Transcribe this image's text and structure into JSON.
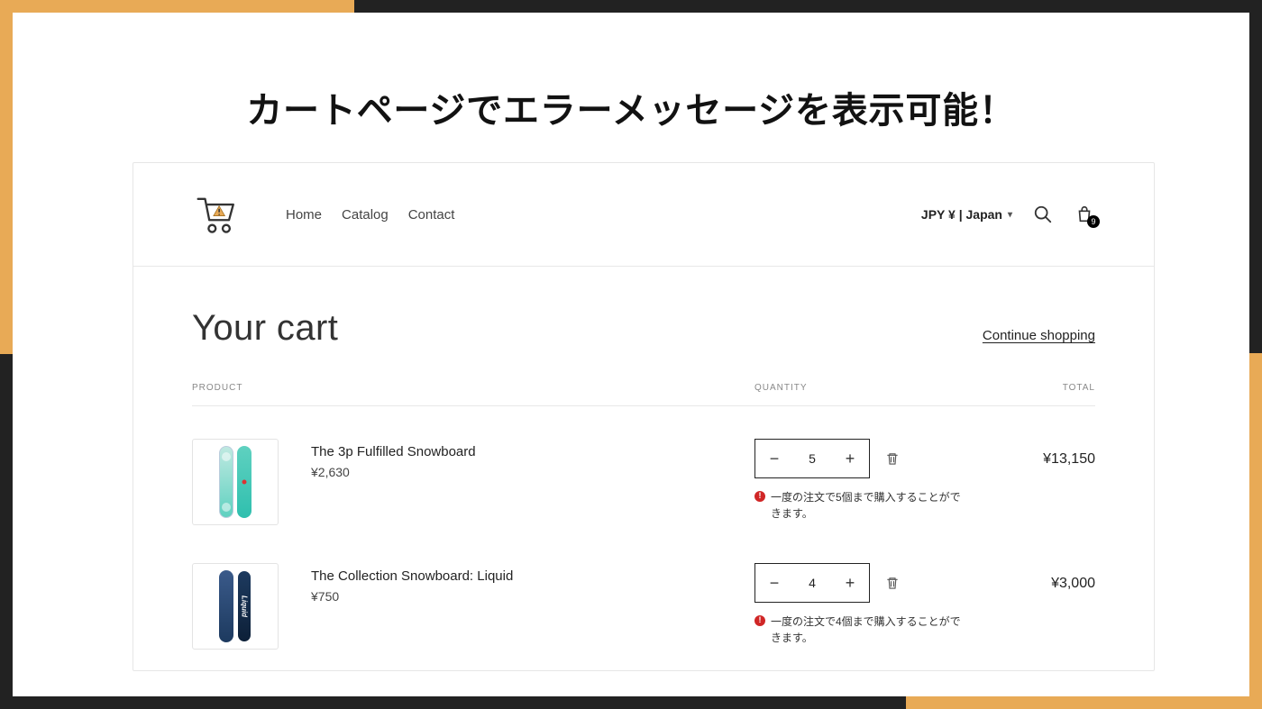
{
  "headline": "カートページでエラーメッセージを表示可能！",
  "nav": {
    "home": "Home",
    "catalog": "Catalog",
    "contact": "Contact"
  },
  "currency_selector": "JPY ¥ | Japan",
  "cart_badge": "9",
  "cart": {
    "title": "Your cart",
    "continue_shopping": "Continue shopping",
    "columns": {
      "product": "PRODUCT",
      "quantity": "QUANTITY",
      "total": "TOTAL"
    },
    "items": [
      {
        "name": "The 3p Fulfilled Snowboard",
        "unit_price": "¥2,630",
        "quantity": "5",
        "line_total": "¥13,150",
        "error": "一度の注文で5個まで購入することができます。"
      },
      {
        "name": "The Collection Snowboard: Liquid",
        "unit_price": "¥750",
        "quantity": "4",
        "line_total": "¥3,000",
        "error": "一度の注文で4個まで購入することができます。"
      }
    ]
  }
}
